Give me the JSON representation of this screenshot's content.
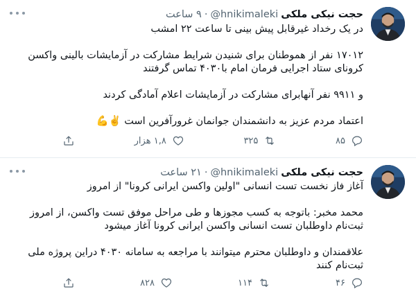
{
  "tweets": [
    {
      "name": "حجت نیکی ملکی",
      "handle": "@hnikimaleki",
      "separator": "·",
      "time": "۹ ساعت",
      "lines": [
        "در یک رخداد غیرقابل پیش بینی تا ساعت ۲۲ امشب",
        "",
        "۱۷۰۱۲ نفر از هموطنان برای شنیدن شرایط مشارکت در آزمایشات بالینی واکسن",
        "کرونای ستاد اجرایی فرمان امام با۴۰۳۰ تماس گرفتند",
        "",
        "و ۹۹۱۱ نفر آنهابرای مشارکت در آزمایشات اعلام آمادگی کردند",
        "",
        "اعتماد مردم عزیز به دانشمندان جوانمان غرورآفرین است ✌️💪"
      ],
      "replies": "۸۵",
      "retweets": "۳۲۵",
      "likes": "۱,۸ هزار"
    },
    {
      "name": "حجت نیکی ملکی",
      "handle": "@hnikimaleki",
      "separator": "·",
      "time": "۲۱ ساعت",
      "lines": [
        "آغاز فاز نخست تست انسانی \"اولین واکسن ایرانی کرونا\" از امروز",
        "",
        "محمد مخبر: باتوجه به کسب مجوزها و طی مراحل موفق تست واکسن، از امروز",
        "ثبت‌نام داوطلبان تست انسانی واکسن ایرانی کرونا آغاز میشود",
        "",
        "علاقمندان و داوطلبان محترم میتوانند با مراجعه به سامانه ۴۰۳۰ دراین پروژه ملی",
        "ثبت‌نام کنند"
      ],
      "replies": "۴۶",
      "retweets": "۱۱۴",
      "likes": "۸۲۸"
    }
  ],
  "icons": {
    "reply": "reply-icon",
    "retweet": "retweet-icon",
    "like": "heart-icon",
    "share": "share-icon",
    "more": "more-icon"
  },
  "colors": {
    "text": "#0f1419",
    "secondary": "#536471",
    "divider": "#e6ecf0"
  }
}
